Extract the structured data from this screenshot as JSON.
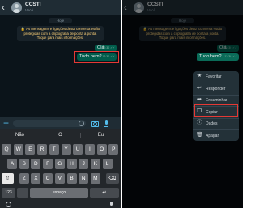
{
  "left_screen": {
    "header": {
      "back": "‹",
      "contact_name": "CCSTI",
      "contact_subtitle": "Você"
    },
    "date_chip": "Hoje",
    "encryption_note": "🔒 As mensagens e ligações desta conversa estão protegidas com a criptografia de ponta a ponta. Toque para mais informações.",
    "messages": [
      {
        "text": "Olá",
        "meta": "12:30 ✓✓"
      },
      {
        "text": "Tudo bem?",
        "meta": "12:30 ✓✓"
      }
    ],
    "input_bar": {
      "plus": "+"
    },
    "keyboard": {
      "suggestions": [
        "Não",
        "O",
        "Eu"
      ],
      "row1": [
        "Q",
        "W",
        "E",
        "R",
        "T",
        "Y",
        "U",
        "I",
        "O",
        "P"
      ],
      "row2": [
        "A",
        "S",
        "D",
        "F",
        "G",
        "H",
        "J",
        "K",
        "L"
      ],
      "row3": [
        "Z",
        "X",
        "C",
        "V",
        "B",
        "N",
        "M"
      ],
      "shift": "⇧",
      "backspace": "⌫",
      "numbers": "123",
      "space": "espaço",
      "return": "↵"
    }
  },
  "right_screen": {
    "header": {
      "back": "‹",
      "contact_name": "CCSTI",
      "contact_subtitle": "Você"
    },
    "date_chip": "Hoje",
    "encryption_note": "🔒 As mensagens e ligações desta conversa estão protegidas com a criptografia de ponta a ponta. Toque para mais informações.",
    "messages": [
      {
        "text": "Olá",
        "meta": "12:30 ✓✓"
      },
      {
        "text": "Tudo bem?",
        "meta": "12:30 ✓✓"
      }
    ],
    "context_menu": {
      "items": [
        {
          "label": "Favoritar",
          "icon": "★",
          "icon_name": "star-icon"
        },
        {
          "label": "Responder",
          "icon": "↩",
          "icon_name": "reply-icon"
        },
        {
          "label": "Encaminhar",
          "icon": "➦",
          "icon_name": "forward-icon"
        },
        {
          "label": "Copiar",
          "icon": "❐",
          "icon_name": "copy-icon"
        },
        {
          "label": "Dados",
          "icon": "ⓘ",
          "icon_name": "info-icon"
        },
        {
          "label": "Apagar",
          "icon": "🗑",
          "icon_name": "trash-icon"
        }
      ]
    }
  },
  "colors": {
    "chat_background": "#0b141a",
    "header": "#1f2c34",
    "outgoing_bubble": "#005c4b",
    "encryption_text": "#ffd279",
    "accent": "#53bdeb",
    "highlight_box": "#e53935",
    "keyboard_background": "#23272b",
    "key": "#6b6e73",
    "menu_background": "#233138"
  }
}
